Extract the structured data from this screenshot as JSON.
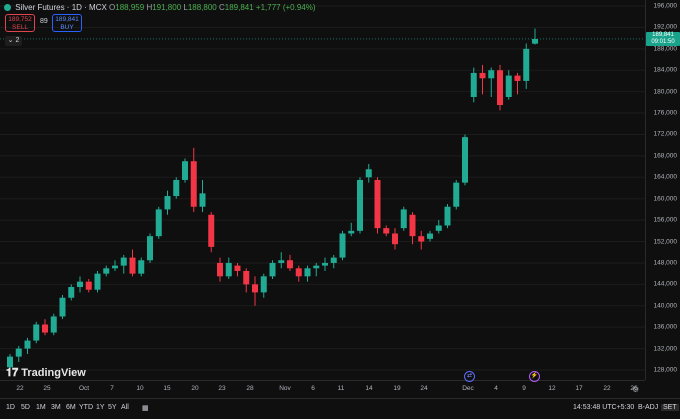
{
  "legend": {
    "symbol": "Silver Futures · 1D · MCX",
    "o_label": "O",
    "o_value": "188,959",
    "h_label": "H",
    "h_value": "191,800",
    "l_label": "L",
    "l_value": "188,800",
    "c_label": "C",
    "c_value": "189,841",
    "change": "+1,777 (+0.94%)"
  },
  "trade": {
    "sell_price": "189,752",
    "sell_label": "SELL",
    "spread": "89",
    "buy_price": "189,841",
    "buy_label": "BUY",
    "collapse_label": "⌄ 2"
  },
  "price_axis": {
    "ticks": [
      "196,000",
      "192,000",
      "188,000",
      "184,000",
      "180,000",
      "176,000",
      "172,000",
      "168,000",
      "164,000",
      "160,000",
      "156,000",
      "152,000",
      "148,000",
      "144,000",
      "140,000",
      "136,000",
      "132,000",
      "128,000"
    ],
    "current_price": "189,841",
    "countdown": "09:01:50"
  },
  "time_axis": {
    "ticks": [
      "22",
      "25",
      "Oct",
      "7",
      "10",
      "15",
      "20",
      "23",
      "28",
      "Nov",
      "6",
      "11",
      "14",
      "19",
      "24",
      "Dec",
      "4",
      "9",
      "12",
      "17",
      "22",
      "26"
    ]
  },
  "bottom_bar": {
    "ranges": [
      "1D",
      "5D",
      "1M",
      "3M",
      "6M",
      "YTD",
      "1Y",
      "5Y",
      "All"
    ],
    "time": "14:53:48 UTC+5:30",
    "adj": "B-ADJ",
    "set": "SET"
  },
  "branding": {
    "logo": "TradingView"
  },
  "events": {
    "blue": "⇄",
    "purple": "⚡"
  },
  "colors": {
    "up": "#22ab94",
    "down": "#f23645",
    "bg": "#0f0f0f",
    "grid": "#1c1c1c"
  },
  "chart_data": {
    "type": "candlestick",
    "ylim": [
      126000,
      197000
    ],
    "yticks": [
      196000,
      192000,
      188000,
      184000,
      180000,
      176000,
      172000,
      168000,
      164000,
      160000,
      156000,
      152000,
      148000,
      144000,
      140000,
      136000,
      132000,
      128000
    ],
    "candles": [
      {
        "o": 128500,
        "h": 131000,
        "l": 127500,
        "c": 130500
      },
      {
        "o": 130500,
        "h": 132500,
        "l": 129500,
        "c": 132000
      },
      {
        "o": 132000,
        "h": 134000,
        "l": 131000,
        "c": 133500
      },
      {
        "o": 133500,
        "h": 137000,
        "l": 133000,
        "c": 136500
      },
      {
        "o": 136500,
        "h": 137500,
        "l": 134500,
        "c": 135000
      },
      {
        "o": 135000,
        "h": 138500,
        "l": 134500,
        "c": 138000
      },
      {
        "o": 138000,
        "h": 142000,
        "l": 137500,
        "c": 141500
      },
      {
        "o": 141500,
        "h": 144000,
        "l": 141000,
        "c": 143500
      },
      {
        "o": 143500,
        "h": 145500,
        "l": 142500,
        "c": 144500
      },
      {
        "o": 144500,
        "h": 145000,
        "l": 142500,
        "c": 143000
      },
      {
        "o": 143000,
        "h": 146500,
        "l": 142500,
        "c": 146000
      },
      {
        "o": 146000,
        "h": 147500,
        "l": 145500,
        "c": 147000
      },
      {
        "o": 147000,
        "h": 148500,
        "l": 146500,
        "c": 147500
      },
      {
        "o": 147500,
        "h": 149500,
        "l": 146000,
        "c": 149000
      },
      {
        "o": 149000,
        "h": 150500,
        "l": 145500,
        "c": 146000
      },
      {
        "o": 146000,
        "h": 149000,
        "l": 145500,
        "c": 148500
      },
      {
        "o": 148500,
        "h": 153500,
        "l": 148000,
        "c": 153000
      },
      {
        "o": 153000,
        "h": 158500,
        "l": 152500,
        "c": 158000
      },
      {
        "o": 158000,
        "h": 161500,
        "l": 157000,
        "c": 160500
      },
      {
        "o": 160500,
        "h": 164000,
        "l": 160000,
        "c": 163500
      },
      {
        "o": 163500,
        "h": 167500,
        "l": 163000,
        "c": 167000
      },
      {
        "o": 167000,
        "h": 169500,
        "l": 157500,
        "c": 158500
      },
      {
        "o": 158500,
        "h": 163500,
        "l": 157500,
        "c": 161000
      },
      {
        "o": 157000,
        "h": 157500,
        "l": 150000,
        "c": 151000
      },
      {
        "o": 148000,
        "h": 149000,
        "l": 144500,
        "c": 145500
      },
      {
        "o": 145500,
        "h": 149000,
        "l": 145000,
        "c": 148000
      },
      {
        "o": 147500,
        "h": 148000,
        "l": 145500,
        "c": 146500
      },
      {
        "o": 146500,
        "h": 147000,
        "l": 142500,
        "c": 144000
      },
      {
        "o": 144000,
        "h": 145500,
        "l": 140000,
        "c": 142500
      },
      {
        "o": 142500,
        "h": 146000,
        "l": 141500,
        "c": 145500
      },
      {
        "o": 145500,
        "h": 148500,
        "l": 145000,
        "c": 148000
      },
      {
        "o": 148000,
        "h": 150000,
        "l": 147000,
        "c": 148500
      },
      {
        "o": 148500,
        "h": 149500,
        "l": 146500,
        "c": 147000
      },
      {
        "o": 147000,
        "h": 147500,
        "l": 144500,
        "c": 145500
      },
      {
        "o": 145500,
        "h": 147500,
        "l": 144500,
        "c": 147000
      },
      {
        "o": 147000,
        "h": 148000,
        "l": 145500,
        "c": 147500
      },
      {
        "o": 147500,
        "h": 149000,
        "l": 146500,
        "c": 148000
      },
      {
        "o": 148000,
        "h": 149500,
        "l": 147000,
        "c": 149000
      },
      {
        "o": 149000,
        "h": 154000,
        "l": 148500,
        "c": 153500
      },
      {
        "o": 153500,
        "h": 155500,
        "l": 153000,
        "c": 154000
      },
      {
        "o": 154000,
        "h": 164000,
        "l": 153500,
        "c": 163500
      },
      {
        "o": 164000,
        "h": 166500,
        "l": 163000,
        "c": 165500
      },
      {
        "o": 163500,
        "h": 164000,
        "l": 153500,
        "c": 154500
      },
      {
        "o": 154500,
        "h": 155000,
        "l": 153000,
        "c": 153500
      },
      {
        "o": 153500,
        "h": 154500,
        "l": 150500,
        "c": 151500
      },
      {
        "o": 154500,
        "h": 158500,
        "l": 154000,
        "c": 158000
      },
      {
        "o": 157000,
        "h": 157500,
        "l": 151500,
        "c": 153000
      },
      {
        "o": 153000,
        "h": 154000,
        "l": 150500,
        "c": 152000
      },
      {
        "o": 152500,
        "h": 154000,
        "l": 152000,
        "c": 153500
      },
      {
        "o": 154000,
        "h": 156000,
        "l": 153500,
        "c": 155000
      },
      {
        "o": 155000,
        "h": 159000,
        "l": 154500,
        "c": 158500
      },
      {
        "o": 158500,
        "h": 163500,
        "l": 158000,
        "c": 163000
      },
      {
        "o": 163000,
        "h": 172000,
        "l": 162500,
        "c": 171500
      },
      {
        "o": 179000,
        "h": 184500,
        "l": 178000,
        "c": 183500
      },
      {
        "o": 183500,
        "h": 185000,
        "l": 179500,
        "c": 182500
      },
      {
        "o": 182500,
        "h": 184500,
        "l": 179000,
        "c": 184000
      },
      {
        "o": 184000,
        "h": 185000,
        "l": 176500,
        "c": 177500
      },
      {
        "o": 179000,
        "h": 184000,
        "l": 178500,
        "c": 183000
      },
      {
        "o": 183000,
        "h": 183500,
        "l": 179500,
        "c": 182000
      },
      {
        "o": 182000,
        "h": 189000,
        "l": 180500,
        "c": 188000
      },
      {
        "o": 188959,
        "h": 191800,
        "l": 188800,
        "c": 189841
      }
    ]
  }
}
